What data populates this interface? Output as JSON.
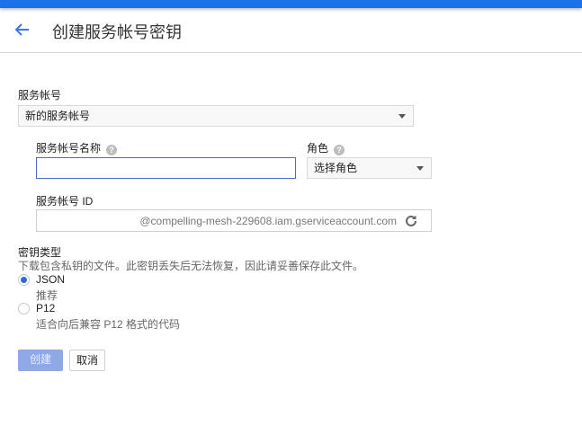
{
  "header": {
    "title": "创建服务帐号密钥",
    "back_icon": "arrow-back-icon"
  },
  "form": {
    "service_account": {
      "label": "服务帐号",
      "selected": "新的服务帐号"
    },
    "name": {
      "label": "服务帐号名称",
      "help": "?",
      "value": ""
    },
    "role": {
      "label": "角色",
      "help": "?",
      "selected": "选择角色"
    },
    "account_id": {
      "label": "服务帐号 ID",
      "suffix": "@compelling-mesh-229608.iam.gserviceaccount.com"
    },
    "key_type": {
      "label": "密钥类型",
      "description": "下载包含私钥的文件。此密钥丢失后无法恢复，因此请妥善保存此文件。",
      "options": [
        {
          "label": "JSON",
          "sub": "推荐",
          "selected": true
        },
        {
          "label": "P12",
          "sub": "适合向后兼容 P12 格式的代码",
          "selected": false
        }
      ]
    }
  },
  "actions": {
    "create": "创建",
    "cancel": "取消"
  },
  "colors": {
    "accent": "#1a73e8",
    "radio": "#3367d6",
    "create_disabled": "#8fa9e6"
  }
}
